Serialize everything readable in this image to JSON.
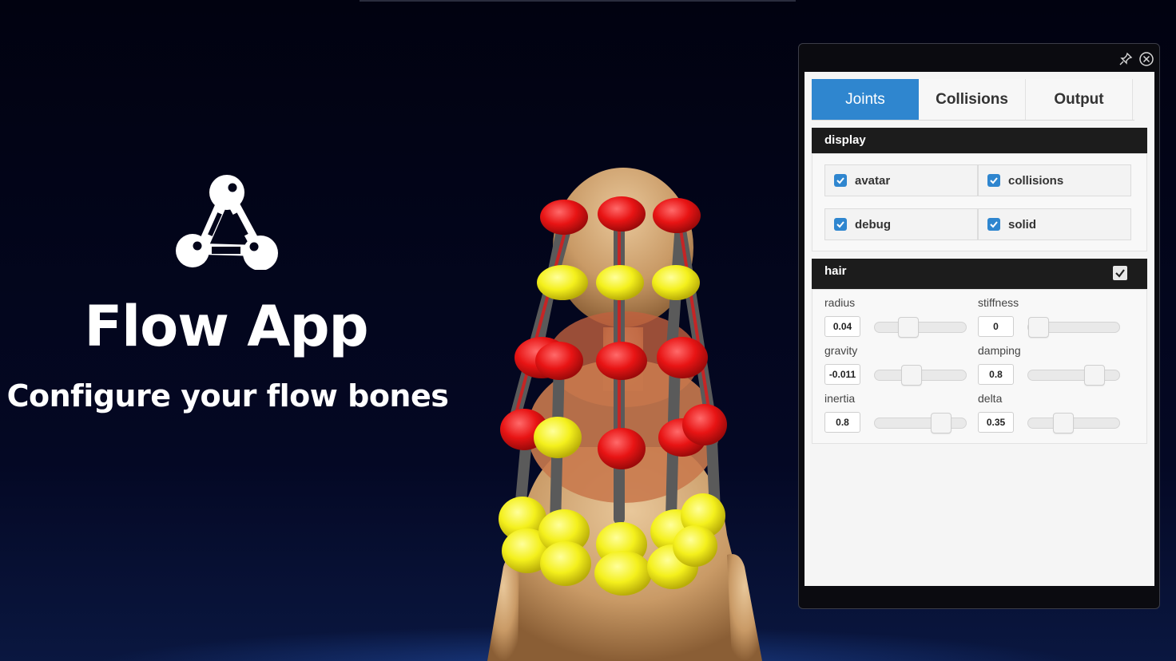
{
  "app": {
    "title": "Flow App",
    "subtitle": "Configure your flow bones"
  },
  "panel": {
    "pin_icon": "pin-icon",
    "close_icon": "close-icon",
    "tabs": [
      {
        "label": "Joints",
        "active": true
      },
      {
        "label": "Collisions",
        "active": false
      },
      {
        "label": "Output",
        "active": false
      }
    ],
    "display": {
      "title": "display",
      "options": [
        {
          "label": "avatar",
          "checked": true
        },
        {
          "label": "collisions",
          "checked": true
        },
        {
          "label": "debug",
          "checked": true
        },
        {
          "label": "solid",
          "checked": true
        }
      ]
    },
    "hair": {
      "title": "hair",
      "enabled": true,
      "params": {
        "radius": {
          "label": "radius",
          "value": "0.04",
          "level": 0.33
        },
        "stiffness": {
          "label": "stiffness",
          "value": "0",
          "level": 0.0
        },
        "gravity": {
          "label": "gravity",
          "value": "-0.011",
          "level": 0.38
        },
        "damping": {
          "label": "damping",
          "value": "0.8",
          "level": 0.8
        },
        "inertia": {
          "label": "inertia",
          "value": "0.8",
          "level": 0.8
        },
        "delta": {
          "label": "delta",
          "value": "0.35",
          "level": 0.35
        }
      }
    }
  },
  "colors": {
    "accent": "#2f86cf",
    "section_header": "#1c1c1c",
    "joint_red": "#e01818",
    "joint_yellow": "#f2f020",
    "bone": "#5a5a5a"
  }
}
